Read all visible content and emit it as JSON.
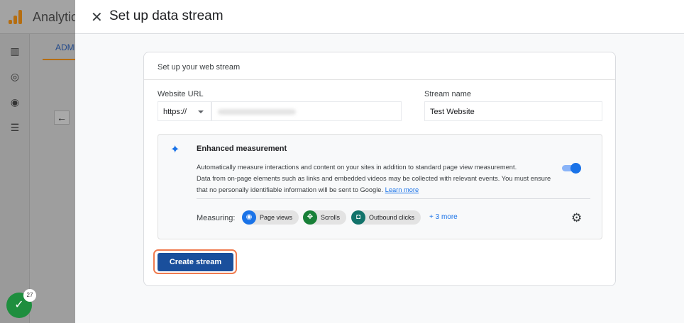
{
  "background": {
    "app_title": "Analytics",
    "tab": "ADMIN",
    "badge_count": "27"
  },
  "dialog": {
    "title": "Set up data stream",
    "card_title": "Set up your web stream",
    "website_url_label": "Website URL",
    "protocol": "https://",
    "stream_name_label": "Stream name",
    "stream_name": "Test Website",
    "enhanced": {
      "title": "Enhanced measurement",
      "desc1": "Automatically measure interactions and content on your sites in addition to standard page view measurement.",
      "desc2": "Data from on-page elements such as links and embedded videos may be collected with relevant events. You must ensure that no personally identifiable information will be sent to Google.",
      "learn_more": "Learn more",
      "enabled": true,
      "measuring_label": "Measuring:",
      "chips": [
        {
          "label": "Page views",
          "color": "#1a73e8"
        },
        {
          "label": "Scrolls",
          "color": "#188038"
        },
        {
          "label": "Outbound clicks",
          "color": "#12736b"
        }
      ],
      "more": "+ 3 more"
    },
    "create_label": "Create stream"
  }
}
